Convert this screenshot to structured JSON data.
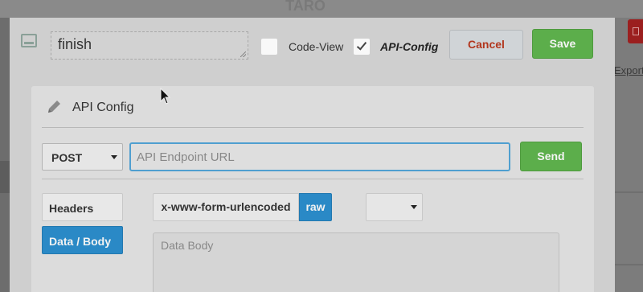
{
  "background": {
    "app_title": "TARO",
    "export_link": "Export"
  },
  "modal": {
    "name_value": "finish",
    "code_view_label": "Code-View",
    "code_view_checked": false,
    "api_config_label": "API-Config",
    "api_config_checked": true,
    "cancel_label": "Cancel",
    "save_label": "Save"
  },
  "panel": {
    "title": "API Config",
    "method": "POST",
    "url_value": "",
    "url_placeholder": "API Endpoint URL",
    "send_label": "Send",
    "tabs": [
      {
        "label": "Headers",
        "active": false
      },
      {
        "label": "Data / Body",
        "active": true
      }
    ],
    "body_formats": [
      {
        "label": "x-www-form-urlencoded",
        "active": false
      },
      {
        "label": "raw",
        "active": true
      }
    ],
    "content_type": "",
    "body_placeholder": "Data Body"
  },
  "colors": {
    "primary": "#2a89c6",
    "success": "#5cae4b",
    "danger_text": "#b2361d",
    "focus_border": "#4f9fd0"
  }
}
